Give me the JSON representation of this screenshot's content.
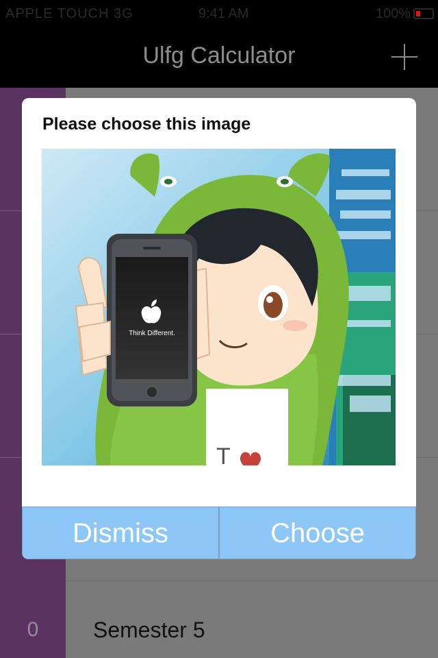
{
  "status_bar": {
    "carrier": "APPLE TOUCH 3G",
    "time": "9:41 AM",
    "battery_text": "100%"
  },
  "navbar": {
    "title": "Ulfg Calculator"
  },
  "list": {
    "rows": [
      {
        "count": "",
        "label": ""
      },
      {
        "count": "",
        "label": ""
      },
      {
        "count": "",
        "label": ""
      },
      {
        "count": "",
        "label": ""
      },
      {
        "count": "0",
        "label": "Semester 5"
      }
    ]
  },
  "dialog": {
    "title": "Please choose this image",
    "image": {
      "phone_text": "Think Different.",
      "shirt_text": "T"
    },
    "buttons": {
      "dismiss": "Dismiss",
      "choose": "Choose"
    }
  },
  "colors": {
    "accent_button": "#8cc7f8",
    "sidebar_purple": "#5a3360",
    "hood_green": "#7bb83a"
  }
}
